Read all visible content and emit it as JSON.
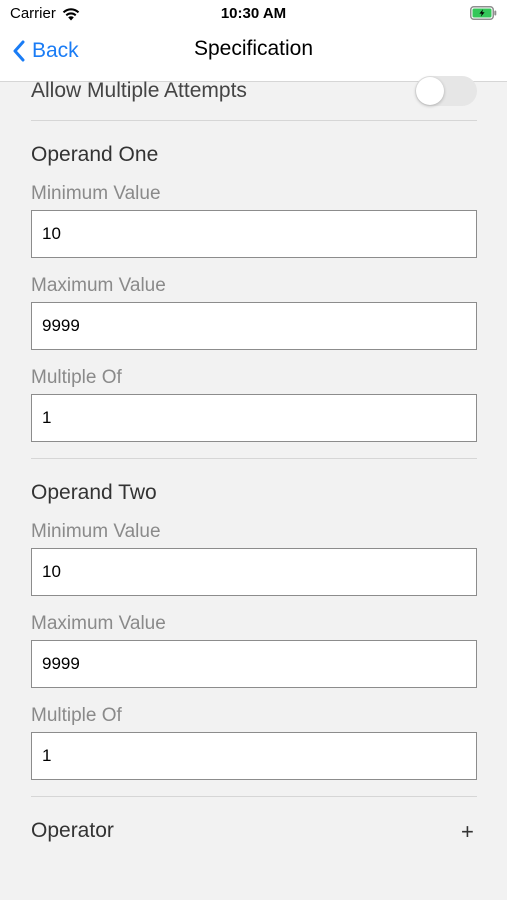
{
  "status_bar": {
    "carrier": "Carrier",
    "time": "10:30 AM"
  },
  "nav": {
    "back_label": "Back",
    "title": "Specification"
  },
  "toggle": {
    "label": "Allow Multiple Attempts",
    "on": false
  },
  "operand_one": {
    "title": "Operand One",
    "min_label": "Minimum Value",
    "min_value": "10",
    "max_label": "Maximum Value",
    "max_value": "9999",
    "multiple_label": "Multiple Of",
    "multiple_value": "1"
  },
  "operand_two": {
    "title": "Operand Two",
    "min_label": "Minimum Value",
    "min_value": "10",
    "max_label": "Maximum Value",
    "max_value": "9999",
    "multiple_label": "Multiple Of",
    "multiple_value": "1"
  },
  "operator": {
    "label": "Operator",
    "add_symbol": "+"
  },
  "colors": {
    "accent": "#1a7cf5",
    "background": "#f2f2f2",
    "battery": "#34c759"
  }
}
